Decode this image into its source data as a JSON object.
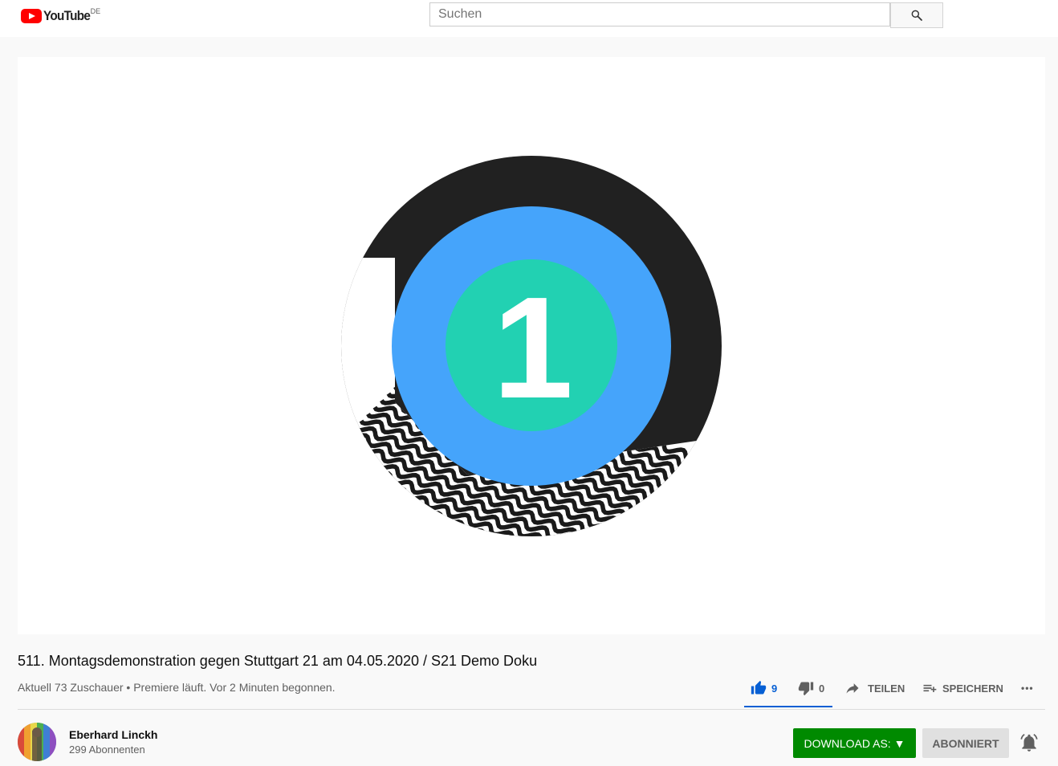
{
  "masthead": {
    "logo_text": "YouTube",
    "country_code": "DE",
    "search_placeholder": "Suchen"
  },
  "video": {
    "countdown_number": "1",
    "title": "511. Montagsdemonstration gegen Stuttgart 21 am 04.05.2020 / S21 Demo Doku",
    "meta": "Aktuell 73 Zuschauer • Premiere läuft. Vor 2 Minuten begonnen."
  },
  "actions": {
    "like_count": "9",
    "dislike_count": "0",
    "share_label": "TEILEN",
    "save_label": "SPEICHERN",
    "more_label": "•••"
  },
  "channel": {
    "name": "Eberhard Linckh",
    "subscribers": "299 Abonnenten",
    "download_label": "DOWNLOAD AS: ▼",
    "subscribe_label": "ABONNIERT"
  },
  "colors": {
    "brand_red": "#ff0000",
    "like_blue": "#065fd4",
    "download_green": "#008a00",
    "ring_dark": "#212121",
    "ring_blue": "#45a4fb",
    "center_teal": "#22d1b2"
  }
}
